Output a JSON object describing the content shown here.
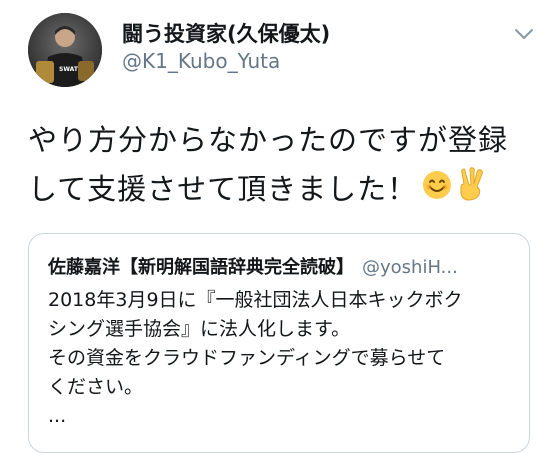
{
  "author": {
    "name": "闘う投資家(久保優太)",
    "handle": "@K1_Kubo_Yuta",
    "avatar_vest_text": "SWAT"
  },
  "tweet": {
    "line1": "やり方分からなかったのですが登録",
    "line2": "して支援させて頂きました！",
    "emojis": [
      "smiling-face-emoji",
      "victory-hand-emoji"
    ]
  },
  "quoted": {
    "name": "佐藤嘉洋【新明解国語辞典完全読破】",
    "handle": "@yoshiH...",
    "lines": [
      "2018年3月9日に『一般社団法人日本キックボク",
      "シング選手協会』に法人化します。",
      "その資金をクラウドファンディングで募らせて",
      "ください。",
      "..."
    ]
  },
  "icons": {
    "caret": "chevron-down-icon"
  },
  "colors": {
    "text": "#14171a",
    "secondary": "#657786",
    "border": "#ccd6dd"
  }
}
